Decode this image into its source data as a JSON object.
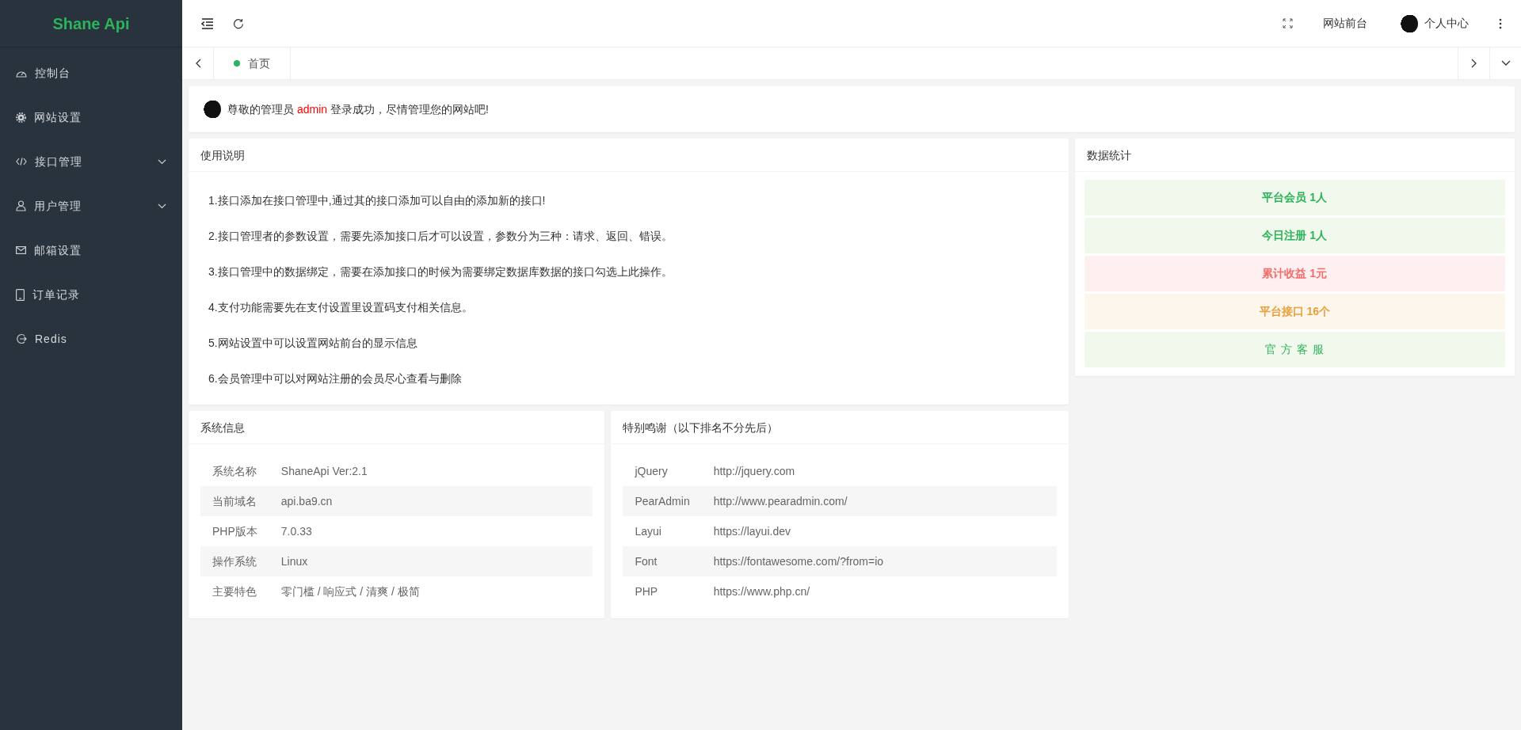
{
  "sidebar": {
    "logo": "Shane Api",
    "items": [
      {
        "label": "控制台",
        "kind": "link"
      },
      {
        "label": "网站设置",
        "kind": "link"
      },
      {
        "label": "接口管理",
        "kind": "group"
      },
      {
        "label": "用户管理",
        "kind": "group"
      },
      {
        "label": "邮箱设置",
        "kind": "link"
      },
      {
        "label": "订单记录",
        "kind": "link"
      },
      {
        "label": "Redis",
        "kind": "link"
      }
    ]
  },
  "header": {
    "frontend_link": "网站前台",
    "user_menu": "个人中心"
  },
  "tabs": [
    {
      "label": "首页",
      "selected": true
    }
  ],
  "welcome": {
    "prefix": "尊敬的管理员",
    "username": "admin",
    "suffix": "登录成功，尽情管理您的网站吧!"
  },
  "usage": {
    "title": "使用说明",
    "lines": [
      "1.接口添加在接口管理中,通过其的接口添加可以自由的添加新的接口!",
      "2.接口管理者的参数设置，需要先添加接口后才可以设置，参数分为三种：请求、返回、错误。",
      "3.接口管理中的数据绑定，需要在添加接口的时候为需要绑定数据库数据的接口勾选上此操作。",
      "4.支付功能需要先在支付设置里设置码支付相关信息。",
      "5.网站设置中可以设置网站前台的显示信息",
      "6.会员管理中可以对网站注册的会员尽心查看与删除"
    ]
  },
  "stats": {
    "title": "数据统计",
    "items": [
      {
        "label": "平台会员 1人",
        "kind": "success"
      },
      {
        "label": "今日注册 1人",
        "kind": "success"
      },
      {
        "label": "累计收益 1元",
        "kind": "danger"
      },
      {
        "label": "平台接口 16个",
        "kind": "warning"
      },
      {
        "label": "官 方 客 服",
        "kind": "service"
      }
    ]
  },
  "system_info": {
    "title": "系统信息",
    "rows": [
      {
        "key": "系统名称",
        "value": "ShaneApi Ver:2.1"
      },
      {
        "key": "当前域名",
        "value": "api.ba9.cn"
      },
      {
        "key": "PHP版本",
        "value": "7.0.33"
      },
      {
        "key": "操作系统",
        "value": "Linux"
      },
      {
        "key": "主要特色",
        "value": "零门槛 / 响应式 / 清爽 / 极简"
      }
    ]
  },
  "thanks": {
    "title": "特别鸣谢（以下排名不分先后）",
    "rows": [
      {
        "key": "jQuery",
        "value": "http://jquery.com"
      },
      {
        "key": "PearAdmin",
        "value": "http://www.pearadmin.com/"
      },
      {
        "key": "Layui",
        "value": "https://layui.dev"
      },
      {
        "key": "Font",
        "value": "https://fontawesome.com/?from=io"
      },
      {
        "key": "PHP",
        "value": "https://www.php.cn/"
      }
    ]
  }
}
